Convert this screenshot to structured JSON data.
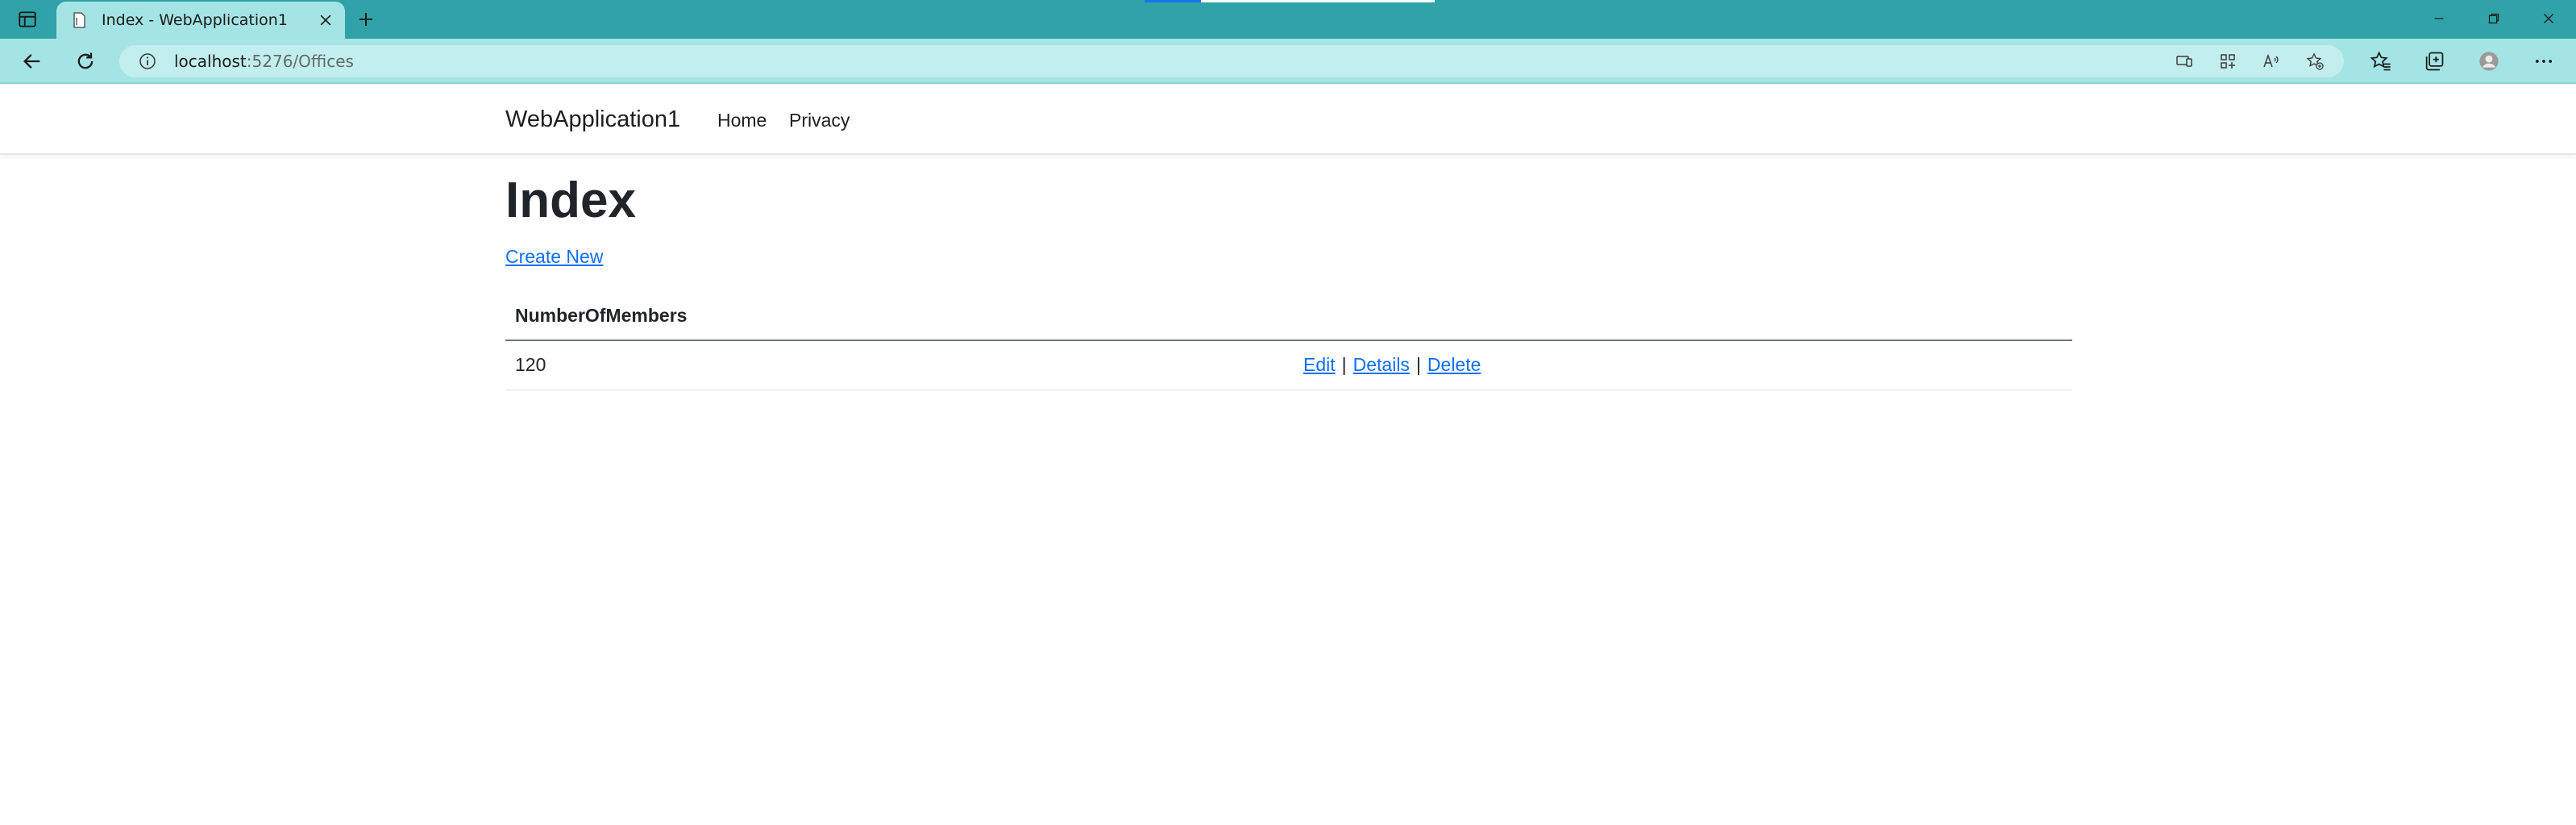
{
  "browser": {
    "tab": {
      "title": "Index - WebApplication1"
    },
    "address_bar": {
      "host": "localhost",
      "path": ":5276/Offices"
    },
    "icons": {
      "tab_actions": "tab-actions-icon",
      "favicon": "page-icon",
      "close_tab": "close-icon",
      "new_tab": "plus-icon",
      "back": "back-arrow-icon",
      "refresh": "refresh-icon",
      "site_info": "info-icon",
      "omnibox_icons": [
        "device-icon",
        "apps-icon",
        "read-aloud-icon",
        "favorite-add-icon"
      ],
      "toolbar_icons": [
        "favorites-icon",
        "collections-icon",
        "profile-icon",
        "more-icon"
      ],
      "window": [
        "minimize-icon",
        "restore-icon",
        "close-window-icon"
      ]
    }
  },
  "navbar": {
    "brand": "WebApplication1",
    "links": [
      {
        "label": "Home"
      },
      {
        "label": "Privacy"
      }
    ]
  },
  "main": {
    "title": "Index",
    "create_link": "Create New",
    "table": {
      "headers": [
        "NumberOfMembers"
      ],
      "rows": [
        {
          "number_of_members": "120",
          "actions": {
            "edit": "Edit",
            "details": "Details",
            "delete": "Delete",
            "separator": "|"
          }
        }
      ]
    }
  },
  "colors": {
    "tabstrip": "#2fa3a8",
    "toolbar": "#a5e4e4",
    "link": "#0d6efd"
  }
}
